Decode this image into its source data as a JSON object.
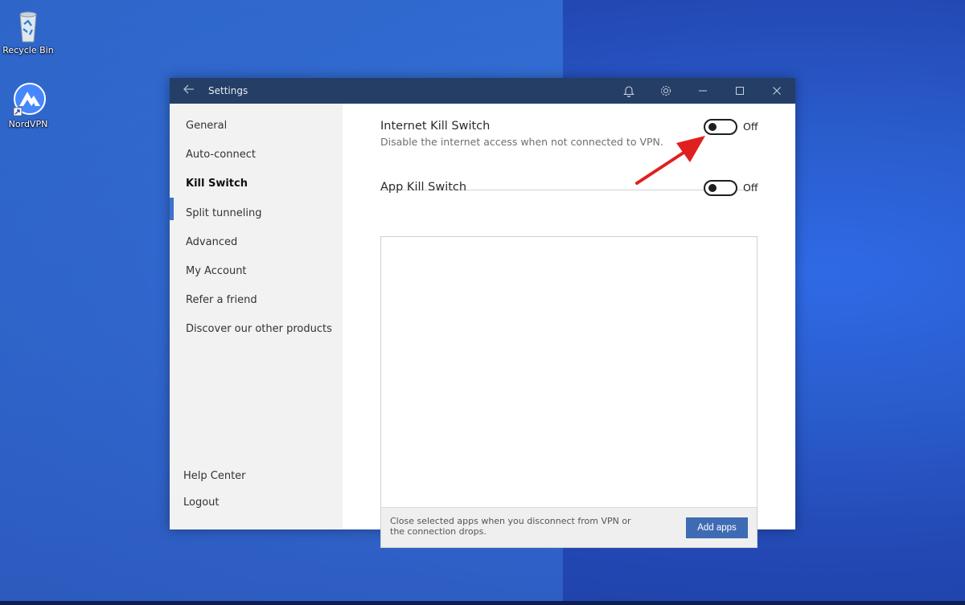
{
  "desktop": {
    "icons": [
      {
        "label": "Recycle Bin",
        "icon": "recycle-bin-icon"
      },
      {
        "label": "NordVPN",
        "icon": "nordvpn-icon"
      }
    ]
  },
  "window": {
    "title": "Settings",
    "icons": [
      "back-arrow-icon",
      "bell-icon",
      "gear-icon",
      "minimize-icon",
      "maximize-icon",
      "close-icon"
    ]
  },
  "sidebar": {
    "items": [
      {
        "label": "General"
      },
      {
        "label": "Auto-connect"
      },
      {
        "label": "Kill Switch",
        "active": true
      },
      {
        "label": "Split tunneling"
      },
      {
        "label": "Advanced"
      },
      {
        "label": "My Account"
      },
      {
        "label": "Refer a friend"
      },
      {
        "label": "Discover our other products"
      }
    ],
    "footer": [
      {
        "label": "Help Center"
      },
      {
        "label": "Logout"
      }
    ]
  },
  "main": {
    "internet_kill_switch": {
      "title": "Internet Kill Switch",
      "description": "Disable the internet access when not connected to VPN.",
      "state": "Off"
    },
    "app_kill_switch": {
      "title": "App Kill Switch",
      "state": "Off",
      "footer_text": "Close selected apps when you disconnect from VPN or the connection drops.",
      "add_button": "Add apps"
    }
  },
  "colors": {
    "titlebar": "#243e66",
    "accent": "#3d73c9",
    "button": "#3f6bb4",
    "annotation_arrow": "#e0201f"
  }
}
